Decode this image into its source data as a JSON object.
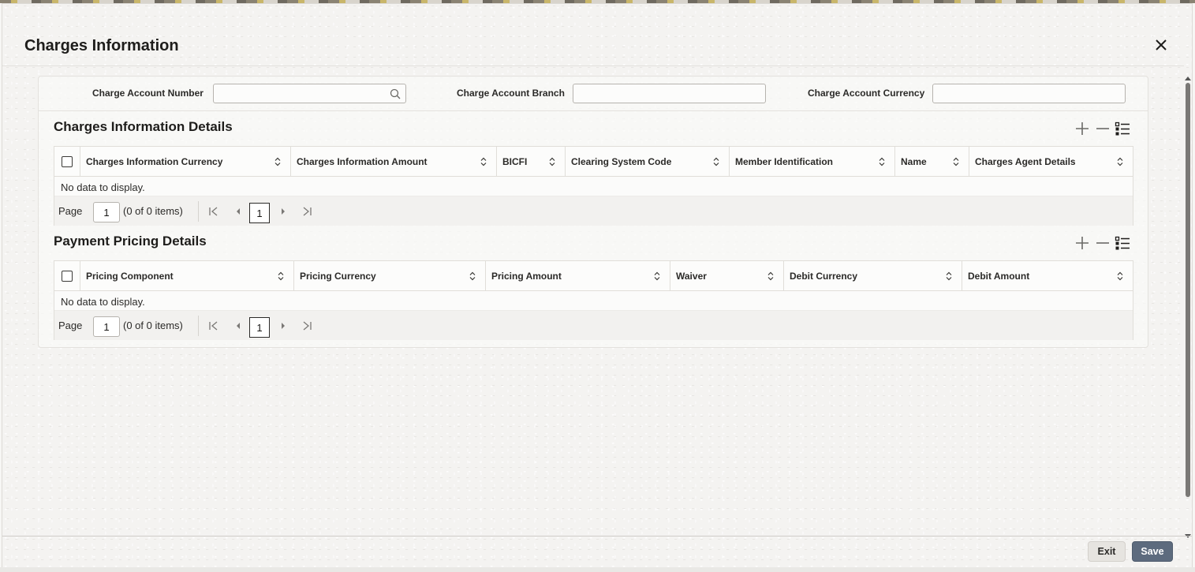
{
  "dialog": {
    "title": "Charges Information",
    "close_icon": "close-icon"
  },
  "fields": {
    "charge_account_number": {
      "label": "Charge Account Number",
      "value": "",
      "icon": "search-icon"
    },
    "charge_account_branch": {
      "label": "Charge Account Branch",
      "value": ""
    },
    "charge_account_currency": {
      "label": "Charge Account Currency",
      "value": ""
    }
  },
  "charges_section": {
    "title": "Charges Information Details",
    "tools": [
      "add-icon",
      "remove-icon",
      "column-list-icon"
    ],
    "columns": [
      "Charges Information Currency",
      "Charges Information Amount",
      "BICFI",
      "Clearing System Code",
      "Member Identification",
      "Name",
      "Charges Agent Details"
    ],
    "empty_text": "No data to display.",
    "pager": {
      "label": "Page",
      "page_value": "1",
      "count_text": "(0 of 0 items)",
      "current_page": "1"
    }
  },
  "pricing_section": {
    "title": "Payment Pricing Details",
    "tools": [
      "add-icon",
      "remove-icon",
      "column-list-icon"
    ],
    "columns": [
      "Pricing Component",
      "Pricing Currency",
      "Pricing Amount",
      "Waiver",
      "Debit Currency",
      "Debit Amount"
    ],
    "empty_text": "No data to display.",
    "pager": {
      "label": "Page",
      "page_value": "1",
      "count_text": "(0 of 0 items)",
      "current_page": "1"
    }
  },
  "footer": {
    "exit_label": "Exit",
    "save_label": "Save"
  },
  "colors": {
    "save_button": "#5d6b7e",
    "text": "#161513"
  }
}
